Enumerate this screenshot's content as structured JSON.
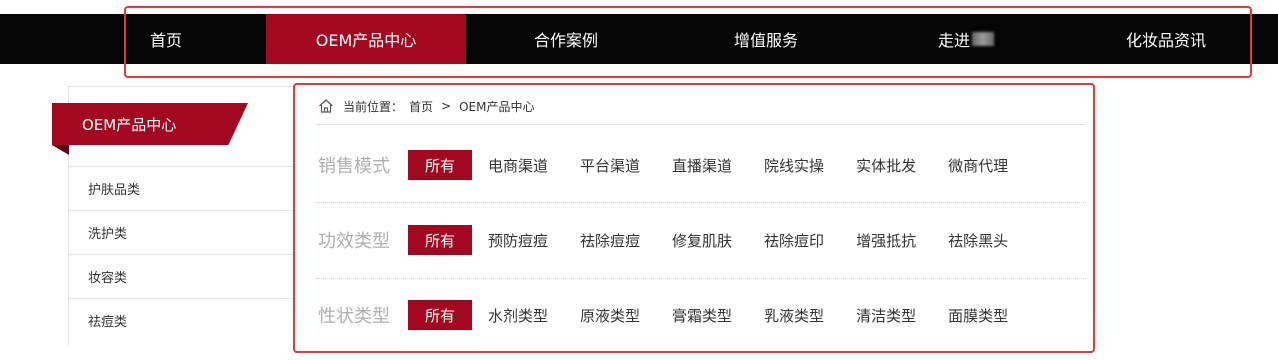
{
  "nav": {
    "items": [
      {
        "label": "首页",
        "active": false
      },
      {
        "label": "OEM产品中心",
        "active": true
      },
      {
        "label": "合作案例",
        "active": false
      },
      {
        "label": "增值服务",
        "active": false
      },
      {
        "label": "走进",
        "active": false
      },
      {
        "label": "化妆品资讯",
        "active": false
      }
    ],
    "accent_color": "#a2081f",
    "background_color": "#050505"
  },
  "sidebar": {
    "title": "OEM产品中心",
    "items": [
      {
        "label": "护肤品类"
      },
      {
        "label": "洗护类"
      },
      {
        "label": "妆容类"
      },
      {
        "label": "祛痘类"
      }
    ]
  },
  "breadcrumb": {
    "icon": "home-icon",
    "prefix": "当前位置：",
    "home": "首页",
    "separator": ">",
    "current": "OEM产品中心"
  },
  "filters": [
    {
      "label": "销售模式",
      "all": "所有",
      "options": [
        "电商渠道",
        "平台渠道",
        "直播渠道",
        "院线实操",
        "实体批发",
        "微商代理"
      ]
    },
    {
      "label": "功效类型",
      "all": "所有",
      "options": [
        "预防痘痘",
        "祛除痘痘",
        "修复肌肤",
        "祛除痘印",
        "增强抵抗",
        "祛除黑头"
      ]
    },
    {
      "label": "性状类型",
      "all": "所有",
      "options": [
        "水剂类型",
        "原液类型",
        "膏霜类型",
        "乳液类型",
        "清洁类型",
        "面膜类型"
      ]
    }
  ],
  "highlight_color": "#e03a3a"
}
